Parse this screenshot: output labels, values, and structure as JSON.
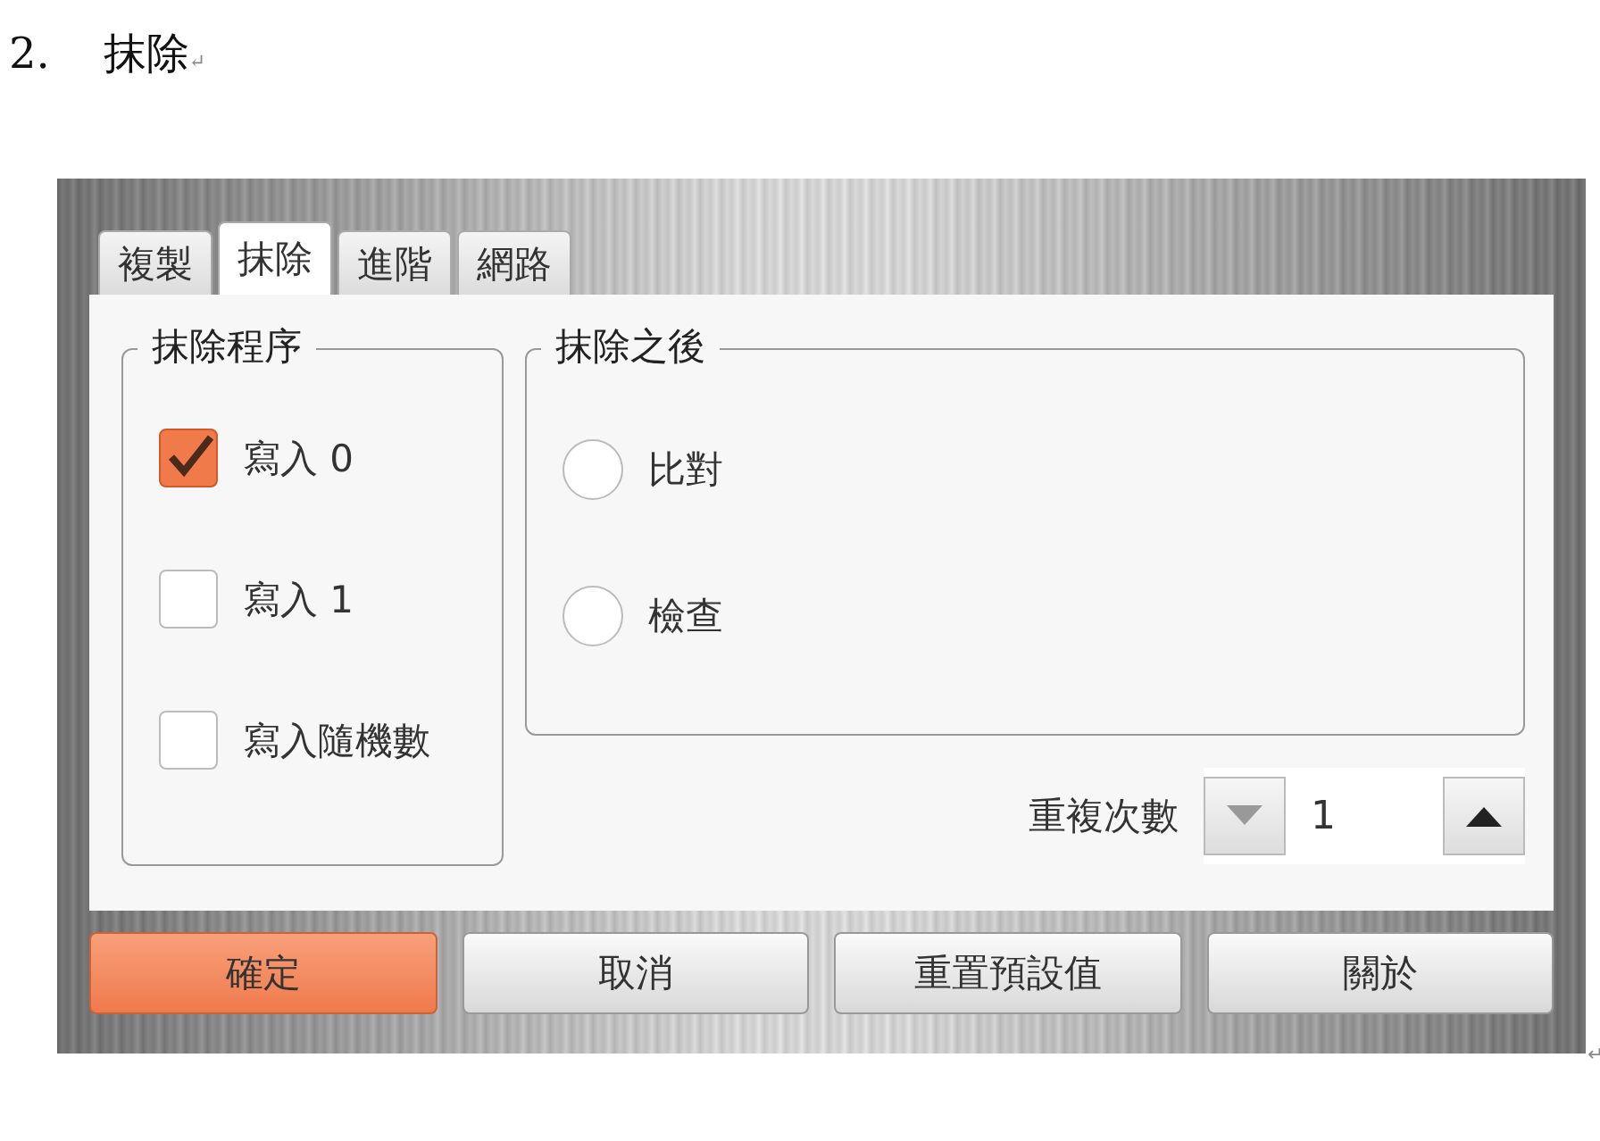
{
  "heading": {
    "number": "2.",
    "title": "抹除",
    "mark": "↵"
  },
  "tabs": [
    {
      "label": "複製",
      "selected": false
    },
    {
      "label": "抹除",
      "selected": true
    },
    {
      "label": "進階",
      "selected": false
    },
    {
      "label": "網路",
      "selected": false
    }
  ],
  "procedure": {
    "title": "抹除程序",
    "options": [
      {
        "label": "寫入 0",
        "checked": true
      },
      {
        "label": "寫入 1",
        "checked": false
      },
      {
        "label": "寫入隨機數",
        "checked": false
      }
    ]
  },
  "after": {
    "title": "抹除之後",
    "options": [
      {
        "label": "比對",
        "selected": false
      },
      {
        "label": "檢查",
        "selected": false
      }
    ]
  },
  "repeat": {
    "label": "重複次數",
    "value": "1"
  },
  "buttons": [
    {
      "label": "確定",
      "primary": true
    },
    {
      "label": "取消",
      "primary": false
    },
    {
      "label": "重置預設值",
      "primary": false
    },
    {
      "label": "關於",
      "primary": false
    }
  ],
  "end_mark": "↵"
}
